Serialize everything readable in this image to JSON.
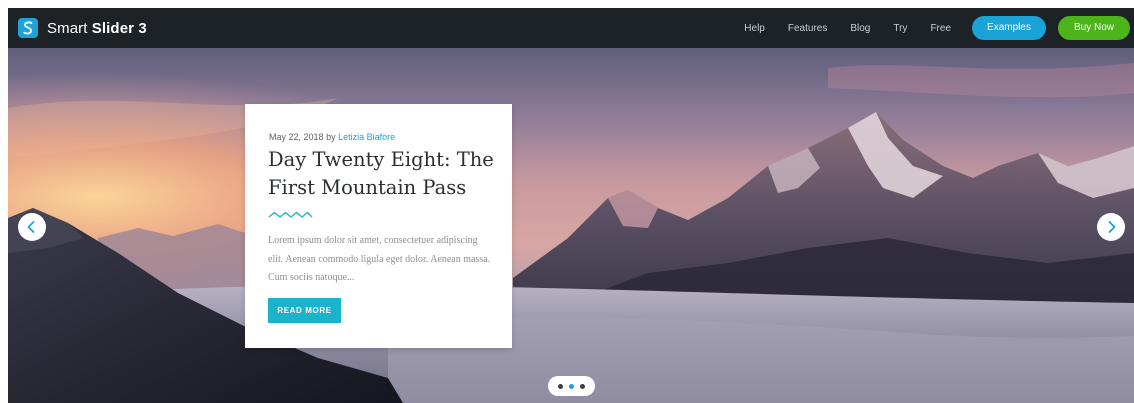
{
  "brand": {
    "name_light": "Smart",
    "name_bold": "Slider 3",
    "logo_icon": "s-logo-icon",
    "accent": "#1aa3d7"
  },
  "nav": {
    "links": [
      "Help",
      "Features",
      "Blog",
      "Try",
      "Free"
    ],
    "examples_label": "Examples",
    "examples_color": "#1aa3d7",
    "buy_label": "Buy Now",
    "buy_color": "#4bb51a"
  },
  "slide": {
    "date": "May 22, 2018",
    "by": "by",
    "author": "Letizia Biafore",
    "title": "Day Twenty Eight: The First Mountain Pass",
    "excerpt": "Lorem ipsum dolor sit amet, consectetuer adipiscing elit. Aenean commodo ligula eget dolor. Aenean massa. Cum sociis natoque...",
    "read_more": "READ MORE",
    "read_more_color": "#1ab3cc"
  },
  "slider": {
    "prev_icon": "chevron-left-icon",
    "next_icon": "chevron-right-icon",
    "bullets": 3,
    "active_bullet": 2
  }
}
